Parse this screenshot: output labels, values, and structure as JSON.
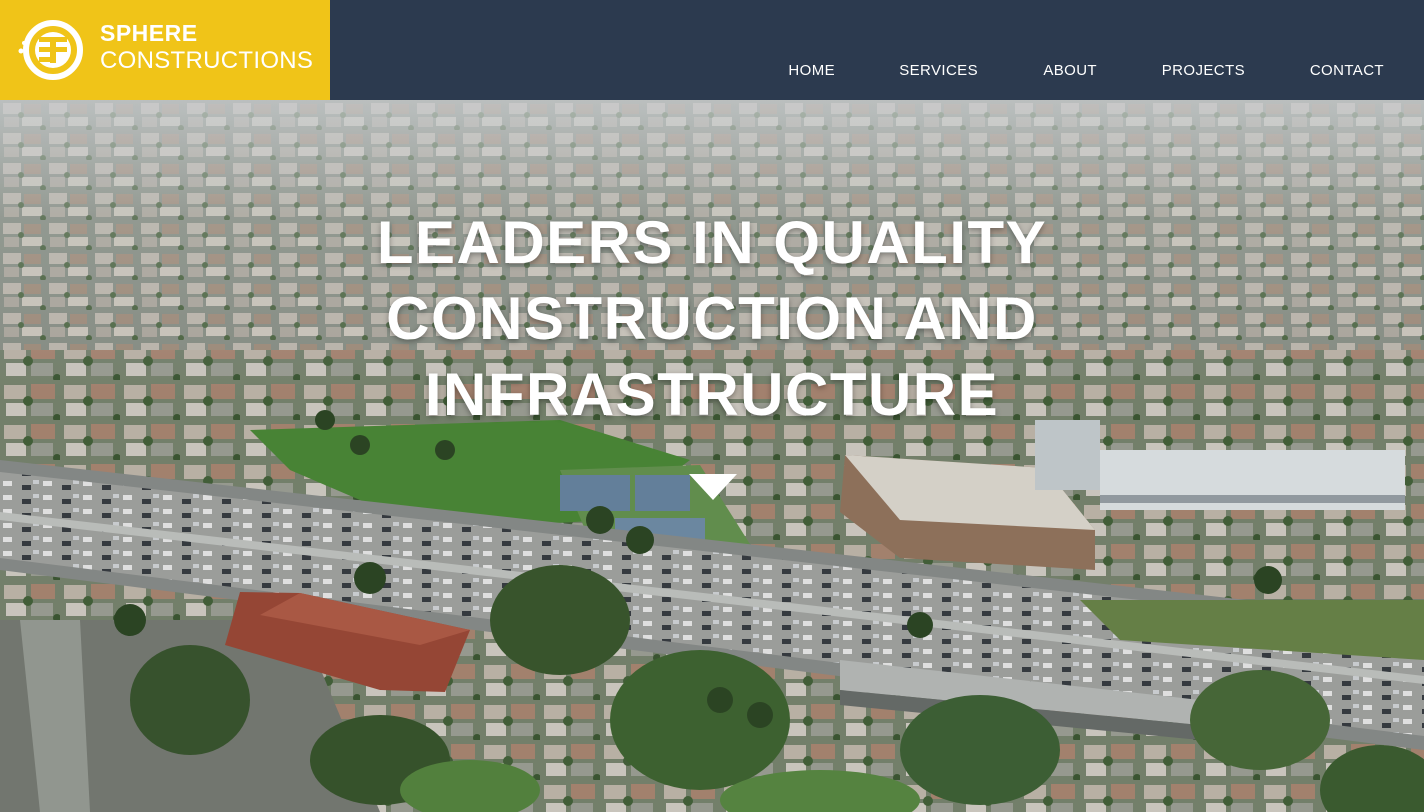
{
  "brand": {
    "name_line1": "SPHERE",
    "name_line2": "CONSTRUCTIONS",
    "logo_icon": "sphere-logo-icon",
    "color": "#f0c418"
  },
  "header": {
    "background": "#2c3a4f"
  },
  "nav": {
    "items": [
      {
        "label": "HOME"
      },
      {
        "label": "SERVICES"
      },
      {
        "label": "ABOUT"
      },
      {
        "label": "PROJECTS"
      },
      {
        "label": "CONTACT"
      }
    ]
  },
  "hero": {
    "title_lines": [
      "LEADERS IN QUALITY",
      "CONSTRUCTION AND",
      "INFRASTRUCTURE"
    ],
    "background": "aerial view of city with freeway",
    "scroll_icon": "chevron-down-icon"
  }
}
